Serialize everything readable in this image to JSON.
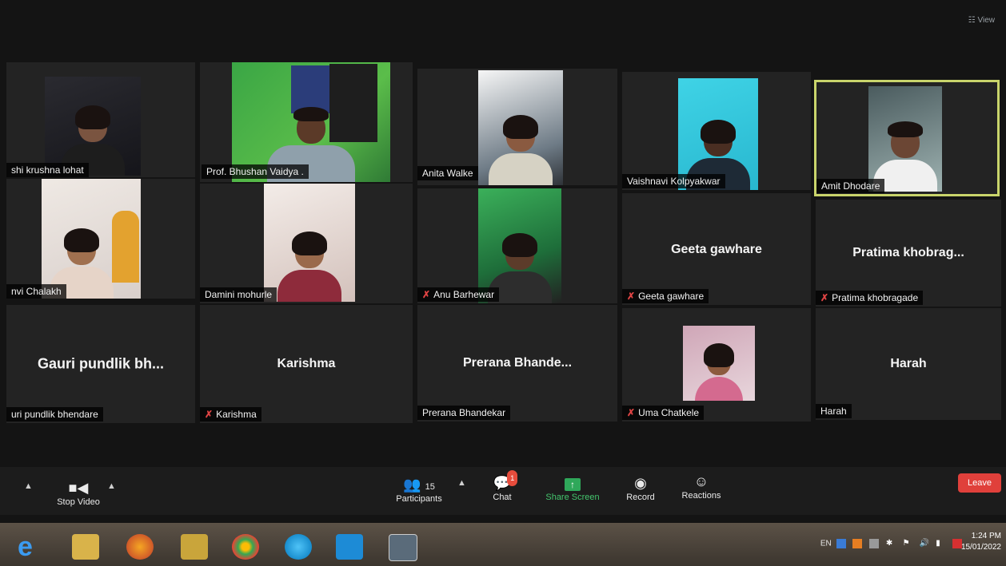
{
  "app": {
    "view_label": "View"
  },
  "tiles": [
    {
      "name": "shi krushna lohat",
      "label": "shi krushna lohat",
      "muted": false,
      "video": true
    },
    {
      "name": "Prof. Bhushan Vaidya .",
      "label": "Prof. Bhushan Vaidya .",
      "muted": false,
      "video": true
    },
    {
      "name": "Anita Walke",
      "label": "Anita Walke",
      "muted": false,
      "video": true
    },
    {
      "name": "Vaishnavi Kolpyakwar",
      "label": "Vaishnavi Kolpyakwar",
      "muted": false,
      "video": true
    },
    {
      "name": "Amit Dhodare",
      "label": "Amit Dhodare",
      "muted": false,
      "video": true,
      "active": true
    },
    {
      "name": "nvi Chalakh",
      "label": "nvi Chalakh",
      "muted": false,
      "video": true
    },
    {
      "name": "Damini mohurle",
      "label": "Damini mohurle",
      "muted": false,
      "video": true
    },
    {
      "name": "Anu Barhewar",
      "label": "Anu Barhewar",
      "muted": true,
      "video": true
    },
    {
      "name": "Geeta gawhare",
      "label": "Geeta gawhare",
      "display": "Geeta gawhare",
      "muted": true,
      "video": false
    },
    {
      "name": "Pratima khobragade",
      "label": "Pratima khobragade",
      "display": "Pratima khobrag...",
      "muted": true,
      "video": false
    },
    {
      "name": "uri pundlik bhendare",
      "label": "uri pundlik bhendare",
      "display": "Gauri pundlik bh...",
      "muted": false,
      "video": false
    },
    {
      "name": "Karishma",
      "label": "Karishma",
      "display": "Karishma",
      "muted": true,
      "video": false
    },
    {
      "name": "Prerana Bhandekar",
      "label": "Prerana Bhandekar",
      "display": "Prerana Bhande...",
      "muted": false,
      "video": false
    },
    {
      "name": "Uma Chatkele",
      "label": "Uma Chatkele",
      "muted": true,
      "video": true
    },
    {
      "name": "Harah",
      "label": "Harah",
      "display": "Harah",
      "muted": false,
      "video": false
    }
  ],
  "toolbar": {
    "stop_video": "Stop Video",
    "participants_label": "Participants",
    "participants_count": "15",
    "chat_label": "Chat",
    "chat_badge": "1",
    "share_label": "Share Screen",
    "record_label": "Record",
    "reactions_label": "Reactions",
    "leave_label": "Leave"
  },
  "taskbar": {
    "lang": "EN",
    "time": "1:24 PM",
    "date": "15/01/2022"
  },
  "colors": {
    "active_speaker_border": "#c9d46b",
    "share_green": "#43c56d",
    "leave_red": "#e0403b",
    "mute_red": "#e04444"
  }
}
